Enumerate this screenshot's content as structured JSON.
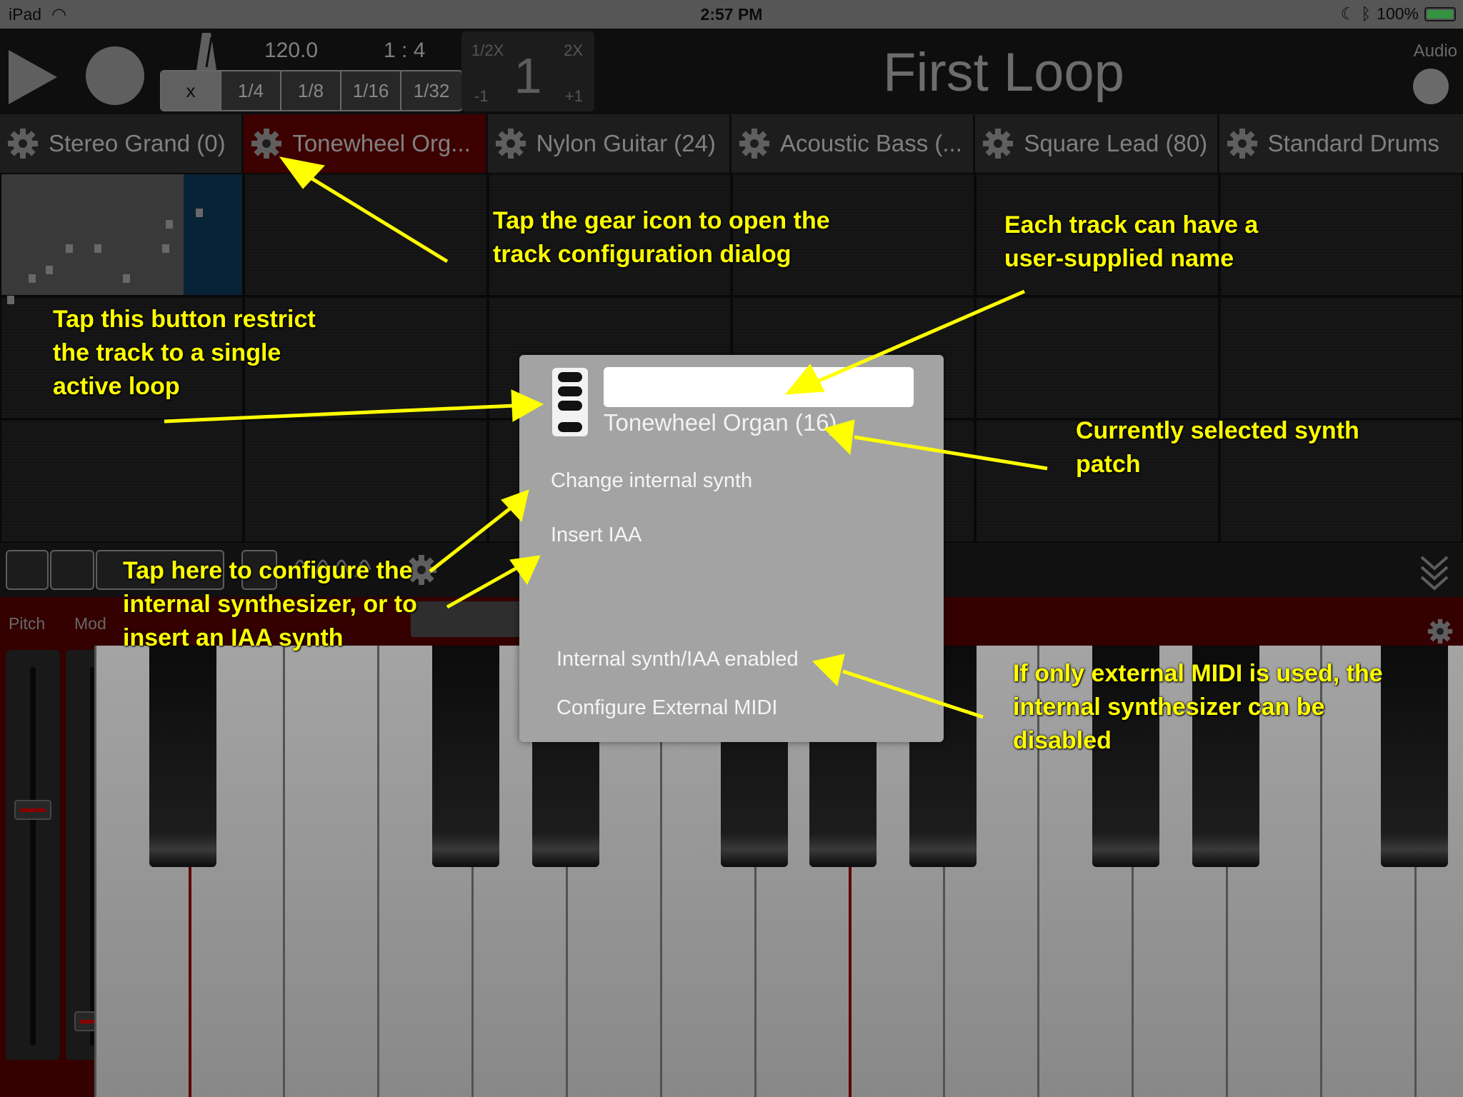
{
  "status_bar": {
    "device": "iPad",
    "time": "2:57 PM",
    "battery": "100%"
  },
  "transport": {
    "tempo": "120.0",
    "time_signature": "1 : 4",
    "quantize": [
      "x",
      "1/4",
      "1/8",
      "1/16",
      "1/32"
    ],
    "zoom": {
      "half": "1/2X",
      "double": "2X",
      "value": "1",
      "minus": "-1",
      "plus": "+1"
    },
    "loop_title": "First Loop",
    "audio_label": "Audio"
  },
  "tracks": [
    {
      "name": "Stereo Grand (0)"
    },
    {
      "name": "Tonewheel Org..."
    },
    {
      "name": "Nylon Guitar (24)"
    },
    {
      "name": "Acoustic Bass (..."
    },
    {
      "name": "Square Lead (80)"
    },
    {
      "name": "Standard Drums"
    }
  ],
  "keyboard": {
    "pitch_label": "Pitch",
    "mod_label": "Mod",
    "pitch_level": 0.37,
    "mod_level": 0.96
  },
  "dialog": {
    "name_value": "",
    "patch": "Tonewheel Organ (16)",
    "change_synth": "Change internal synth",
    "insert_iaa": "Insert IAA",
    "synth_enabled": "Internal synth/IAA enabled",
    "configure_midi": "Configure External MIDI"
  },
  "annotations": {
    "gear": "Tap the gear icon to open the track configuration dialog",
    "name": "Each track can have a user-supplied name",
    "restrict": "Tap this button restrict the track to a single active loop",
    "patch": "Currently selected synth patch",
    "configure": "Tap here to configure the internal synthesizer, or to insert an IAA synth",
    "midi": "If only external MIDI is used, the internal synthesizer can be disabled"
  },
  "colors": {
    "accent_track": "#5a0000",
    "annotation": "#ffff00",
    "dialog_bg": "#a3a3a3"
  }
}
